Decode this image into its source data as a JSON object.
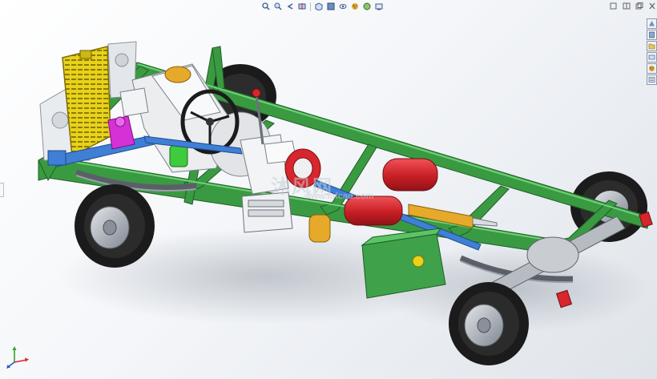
{
  "watermark": {
    "text_cn": "沐风网",
    "url": "www.mfcad.com"
  },
  "heads_up_toolbar": {
    "buttons": [
      "zoom-to-fit-icon",
      "zoom-to-area-icon",
      "previous-view-icon",
      "section-view-icon",
      "view-orientation-icon",
      "display-style-icon",
      "hide-show-items-icon",
      "edit-appearance-icon",
      "apply-scene-icon",
      "view-settings-icon"
    ]
  },
  "window_controls": [
    "restore-icon",
    "tile-icon",
    "maximize-icon",
    "close-icon"
  ],
  "task_pane": [
    "resources-icon",
    "design-library-icon",
    "file-explorer-icon",
    "view-palette-icon",
    "appearances-icon",
    "custom-properties-icon"
  ],
  "triad": {
    "axes": [
      "X",
      "Y",
      "Z"
    ]
  },
  "colors": {
    "frame_green": "#3a9a42",
    "radiator_yellow": "#e8d21a",
    "tank_red": "#d7262d",
    "shaft_blue": "#3f7fd6",
    "tire_black": "#1b1b1b",
    "hub_grey": "#b5bac1",
    "steering_magenta": "#d531d6",
    "cylinder_orange": "#e6a92a",
    "box_green": "#3fa24a"
  }
}
